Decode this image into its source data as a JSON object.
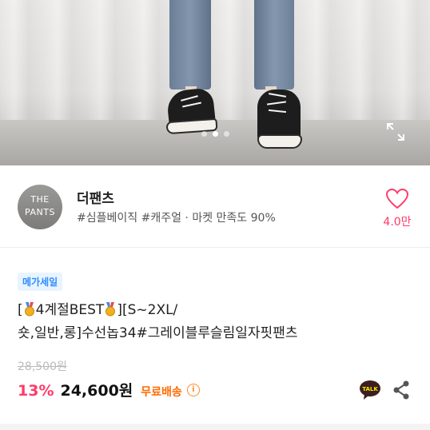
{
  "gallery": {
    "image_icon": "product-photo",
    "page_count": 3,
    "active_page": 2,
    "expand_icon": "expand-icon"
  },
  "shop": {
    "avatar_lines": [
      "THE",
      "PANTS"
    ],
    "name": "더팬츠",
    "tags": [
      "#심플베이직",
      "#캐주얼"
    ],
    "separator": "·",
    "satisfaction": "마켓 만족도 90%",
    "like_icon": "heart-icon",
    "like_count": "4.0만"
  },
  "product": {
    "badge": "메가세일",
    "title_part1": "[",
    "title_part2": "4계절BEST",
    "title_part3": "][S~2XL/",
    "title_line2": "숏,일반,롱]수선놉34#그레이블루슬림일자핏팬츠",
    "original_price": "28,500원",
    "discount": "13%",
    "price": "24,600원",
    "shipping": "무료배송",
    "talk_label": "TALK",
    "talk_icon": "kakaotalk-icon",
    "share_icon": "share-icon"
  },
  "colors": {
    "accent_pink": "#ff3b6b",
    "shipping_orange": "#ff6a00",
    "badge_blue": "#2f8cff"
  }
}
